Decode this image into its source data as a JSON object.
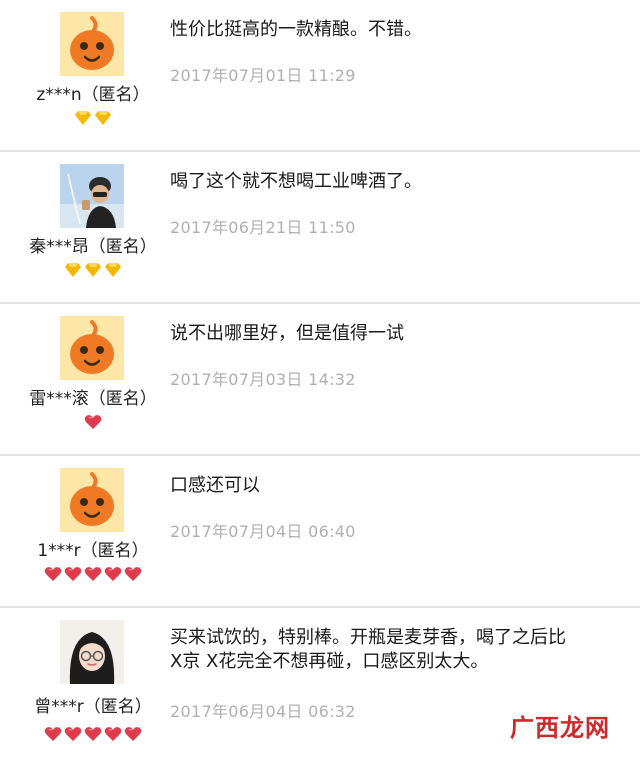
{
  "reviews": [
    {
      "username": "z***n（匿名）",
      "comment": "性价比挺高的一款精酿。不错。",
      "timestamp": "2017年07月01日 11:29",
      "avatar": "default-avatar",
      "badge_type": "gold-diamond",
      "badge_count": 2
    },
    {
      "username": "秦***昂（匿名）",
      "comment": "喝了这个就不想喝工业啤酒了。",
      "timestamp": "2017年06月21日 11:50",
      "avatar": "photo-avatar-man",
      "badge_type": "gold-diamond",
      "badge_count": 3
    },
    {
      "username": "雷***滚（匿名）",
      "comment": "说不出哪里好，但是值得一试",
      "timestamp": "2017年07月03日 14:32",
      "avatar": "default-avatar",
      "badge_type": "red-heart",
      "badge_count": 1
    },
    {
      "username": "1***r（匿名）",
      "comment": "口感还可以",
      "timestamp": "2017年07月04日 06:40",
      "avatar": "default-avatar",
      "badge_type": "red-heart",
      "badge_count": 5
    },
    {
      "username": "曾***r（匿名）",
      "comment": "买来试饮的，特别棒。开瓶是麦芽香，喝了之后比\nX京 X花完全不想再碰，口感区别太大。",
      "timestamp": "2017年06月04日 06:32",
      "avatar": "photo-avatar-woman",
      "badge_type": "red-heart",
      "badge_count": 5
    }
  ],
  "watermark": "广西龙网",
  "colors": {
    "gold": "#f5b800",
    "heart": "#e23b4e",
    "default_avatar_bg": "#fde6a8",
    "default_avatar_figure": "#f07a24",
    "divider": "#e4e4e4",
    "timestamp": "#b0b0b0",
    "watermark": "#cc2a2a"
  }
}
